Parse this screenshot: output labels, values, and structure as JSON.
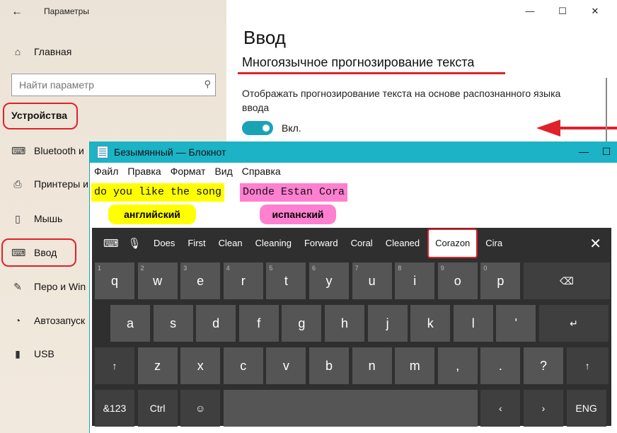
{
  "settings": {
    "window_title": "Параметры",
    "sidebar": {
      "home": "Главная",
      "search_placeholder": "Найти параметр",
      "section": "Устройства",
      "items": [
        {
          "label": "Bluetooth и",
          "icon": "keyboard-icon"
        },
        {
          "label": "Принтеры и",
          "icon": "printer-icon"
        },
        {
          "label": "Мышь",
          "icon": "mouse-icon"
        },
        {
          "label": "Ввод",
          "icon": "keyboard-icon"
        },
        {
          "label": "Перо и Win",
          "icon": "pen-icon"
        },
        {
          "label": "Автозапуск",
          "icon": "autoplay-icon"
        },
        {
          "label": "USB",
          "icon": "usb-icon"
        }
      ]
    },
    "content": {
      "title": "Ввод",
      "subtitle": "Многоязычное прогнозирование текста",
      "description": "Отображать прогнозирование текста на основе распознанного языка ввода",
      "toggle_label": "Вкл.",
      "toggle_on": true
    }
  },
  "notepad": {
    "title": "Безымянный — Блокнот",
    "menu": [
      "Файл",
      "Правка",
      "Формат",
      "Вид",
      "Справка"
    ],
    "text_en": "do you like the song",
    "text_es": "Donde Estan Cora",
    "label_en": "английский",
    "label_es": "испанский"
  },
  "keyboard": {
    "candidates": [
      "Does",
      "First",
      "Clean",
      "Cleaning",
      "Forward",
      "Coral",
      "Cleaned",
      "Corazon",
      "Cira"
    ],
    "selected_candidate": "Corazon",
    "row1": [
      "q",
      "w",
      "e",
      "r",
      "t",
      "y",
      "u",
      "i",
      "o",
      "p"
    ],
    "row1_nums": [
      "1",
      "2",
      "3",
      "4",
      "5",
      "6",
      "7",
      "8",
      "9",
      "0"
    ],
    "row2": [
      "a",
      "s",
      "d",
      "f",
      "g",
      "h",
      "j",
      "k",
      "l",
      "'"
    ],
    "row3": [
      "z",
      "x",
      "c",
      "v",
      "b",
      "n",
      "m",
      ",",
      ".",
      "?"
    ],
    "fn_keys": {
      "numbers": "&123",
      "ctrl": "Ctrl",
      "lang": "ENG"
    },
    "glyphs": {
      "backspace": "⌫",
      "enter": "↵",
      "shift": "↑",
      "emoji": "☺",
      "left": "‹",
      "right": "›",
      "close": "✕"
    }
  },
  "colors": {
    "accent_teal": "#1bb3c5",
    "highlight_red": "#e0212a",
    "english_yellow": "#ffff00",
    "spanish_pink": "#ff7fd0"
  }
}
